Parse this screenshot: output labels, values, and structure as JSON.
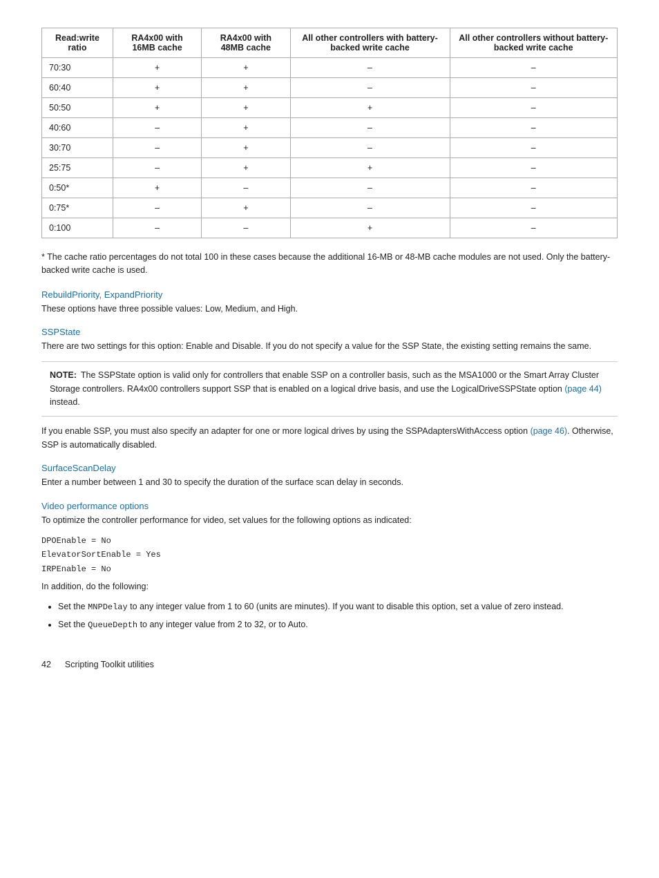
{
  "table": {
    "headers": [
      "Read:write ratio",
      "RA4x00 with 16MB cache",
      "RA4x00 with 48MB cache",
      "All other controllers with battery-backed write cache",
      "All other controllers without battery-backed write cache"
    ],
    "rows": [
      [
        "70:30",
        "+",
        "+",
        "–",
        "–"
      ],
      [
        "60:40",
        "+",
        "+",
        "–",
        "–"
      ],
      [
        "50:50",
        "+",
        "+",
        "+",
        "–"
      ],
      [
        "40:60",
        "–",
        "+",
        "–",
        "–"
      ],
      [
        "30:70",
        "–",
        "+",
        "–",
        "–"
      ],
      [
        "25:75",
        "–",
        "+",
        "+",
        "–"
      ],
      [
        "0:50*",
        "+",
        "–",
        "–",
        "–"
      ],
      [
        "0:75*",
        "–",
        "+",
        "–",
        "–"
      ],
      [
        "0:100",
        "–",
        "–",
        "+",
        "–"
      ]
    ]
  },
  "footnote": "* The cache ratio percentages do not total 100 in these cases because the additional 16-MB or 48-MB cache modules are not used. Only the battery-backed write cache is used.",
  "sections": {
    "rebuild_priority": {
      "heading": "RebuildPriority, ExpandPriority",
      "body": "These options have three possible values: Low, Medium, and High."
    },
    "ssp_state": {
      "heading": "SSPState",
      "body": "There are two settings for this option: Enable and Disable. If you do not specify a value for the SSP State, the existing setting remains the same."
    },
    "note": {
      "label": "NOTE:",
      "text": "The SSPState option is valid only for controllers that enable SSP on a controller basis, such as the MSA1000 or the Smart Array Cluster Storage controllers. RA4x00 controllers support SSP that is enabled on a logical drive basis, and use the LogicalDriveSSPState option ",
      "link_text": "(page 44)",
      "link_href": "#page44",
      "text2": " instead."
    },
    "ssp_enable": {
      "body_pre": "If you enable SSP, you must also specify an adapter for one or more logical drives by using the SSPAdaptersWithAccess option ",
      "link_text": "(page 46)",
      "link_href": "#page46",
      "body_post": ". Otherwise, SSP is automatically disabled."
    },
    "surface_scan_delay": {
      "heading": "SurfaceScanDelay",
      "body": "Enter a number between 1 and 30 to specify the duration of the surface scan delay in seconds."
    },
    "video_performance": {
      "heading": "Video performance options",
      "body": "To optimize the controller performance for video, set values for the following options as indicated:",
      "code_lines": [
        "DPOEnable = No",
        "ElevatorSortEnable = Yes",
        "IRPEnable = No"
      ],
      "additional_label": "In addition, do the following:",
      "bullets": [
        {
          "pre": "Set the ",
          "code": "MNPDelay",
          "post": " to any integer value from 1 to 60 (units are minutes). If you want to disable this option, set a value of zero instead."
        },
        {
          "pre": "Set the ",
          "code": "QueueDepth",
          "post": " to any integer value from 2 to 32, or to Auto."
        }
      ]
    }
  },
  "footer": {
    "page_number": "42",
    "label": "Scripting Toolkit utilities"
  }
}
